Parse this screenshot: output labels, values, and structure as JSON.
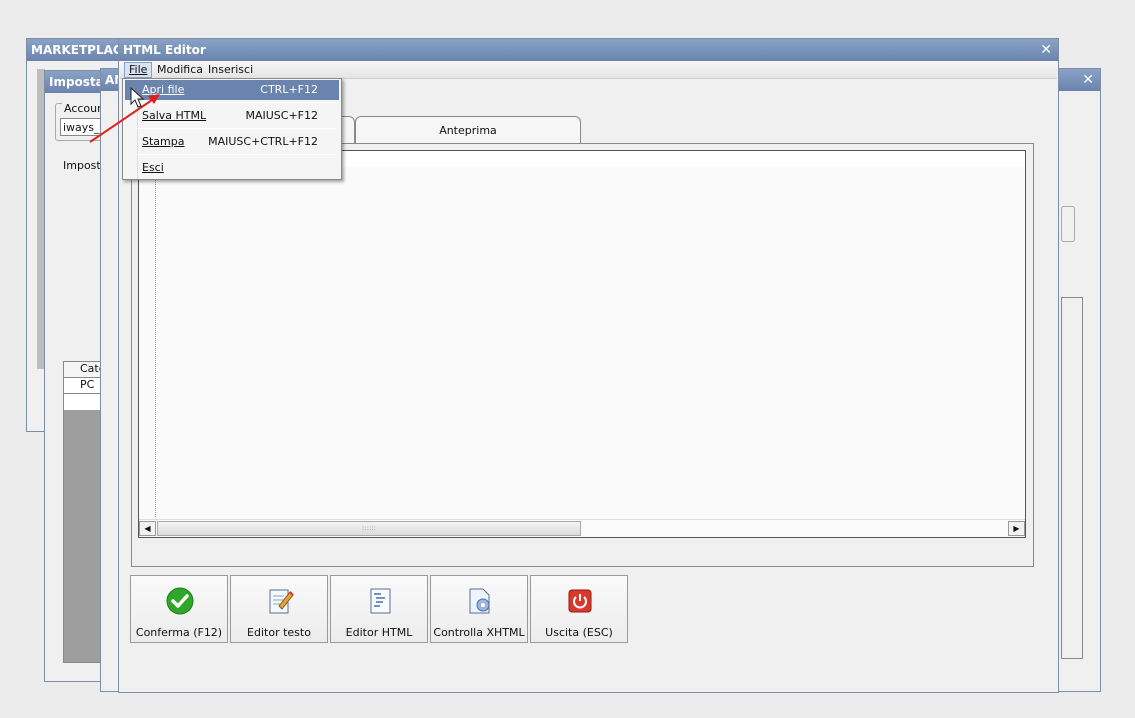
{
  "back_windows": {
    "marketplace_title": "MARKETPLACE",
    "imposta_title": "Imposta",
    "back2_title": "AN",
    "account_label": "Account",
    "account_value": "iways_t",
    "impost_tab": "Imposta",
    "grid_header": "Cate",
    "grid_row": "PC"
  },
  "editor": {
    "title": "HTML Editor",
    "menu": {
      "file": "File",
      "modifica": "Modifica",
      "inserisci": "Inserisci"
    },
    "tabs": {
      "preview": "Anteprima"
    },
    "buttons": {
      "confirm": "Conferma (F12)",
      "text_editor": "Editor testo",
      "html_editor": "Editor HTML",
      "check_xhtml": "Controlla XHTML",
      "exit": "Uscita (ESC)"
    }
  },
  "file_menu": {
    "open": {
      "label": "Apri file",
      "shortcut": "CTRL+F12"
    },
    "save": {
      "label": "Salva HTML",
      "shortcut": "MAIUSC+F12"
    },
    "print": {
      "label": "Stampa",
      "shortcut": "MAIUSC+CTRL+F12"
    },
    "exit": {
      "label": "Esci"
    }
  },
  "colors": {
    "titlebar": "#6a84ad",
    "highlight": "#6b84ad",
    "confirm_green": "#2fa82a",
    "exit_red": "#d9392b"
  }
}
